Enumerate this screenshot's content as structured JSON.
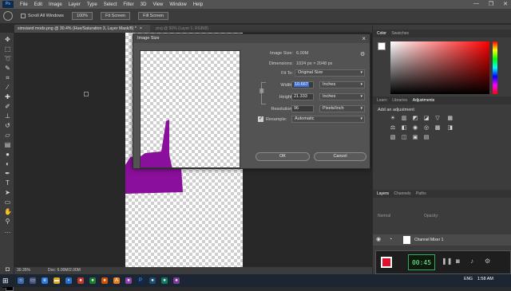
{
  "menubar": {
    "logo": "Ps",
    "items": [
      "File",
      "Edit",
      "Image",
      "Layer",
      "Type",
      "Select",
      "Filter",
      "3D",
      "View",
      "Window",
      "Help"
    ],
    "window_buttons": [
      "—",
      "❐",
      "✕"
    ]
  },
  "options_bar": {
    "scroll_all_windows": "Scroll All Windows",
    "zoom": "100%",
    "fit_screen": "Fit Screen",
    "fill_screen": "Fill Screen"
  },
  "document": {
    "tab_title": "simsiand mods.png @ 30.4% (Hue/Saturation 3, Layer Mask/8) *",
    "tab_close": "×",
    "second_tab": ".png @ 50% (Layer 1, RGB/8)",
    "canvas_shape_color": "#8a0f9a"
  },
  "status_bar": {
    "zoom": "30.35%",
    "doc_size": "Doc: 6.00M/2.00M"
  },
  "image_size_dialog": {
    "title": "Image Size",
    "image_size_label": "Image Size:",
    "image_size_value": "6.00M",
    "dimensions_label": "Dimensions:",
    "dimensions_value": "1024 px  ×  2048 px",
    "fit_to_label": "Fit To:",
    "fit_to_value": "Original Size",
    "width_label": "Width:",
    "width_value": "10.667",
    "width_unit": "Inches",
    "height_label": "Height:",
    "height_value": "21.333",
    "height_unit": "Inches",
    "resolution_label": "Resolution:",
    "resolution_value": "96",
    "resolution_unit": "Pixels/Inch",
    "resample_label": "Resample:",
    "resample_value": "Automatic",
    "resample_checked": true,
    "ok_label": "OK",
    "cancel_label": "Cancel"
  },
  "right_panel": {
    "color_tabs": [
      "Color",
      "Swatches"
    ],
    "adj_tabs": [
      "Learn",
      "Libraries",
      "Adjustments"
    ],
    "adjustments_title": "Add an adjustment",
    "layers_tabs": [
      "Layers",
      "Channels",
      "Paths"
    ],
    "kind_label": "Normal",
    "opacity_label": "Opacity:",
    "layer_name": "Channel Mixer 1"
  },
  "recorder": {
    "timer": "00:45"
  },
  "taskbar": {
    "lang": "ENG",
    "time": "1:58 AM"
  }
}
